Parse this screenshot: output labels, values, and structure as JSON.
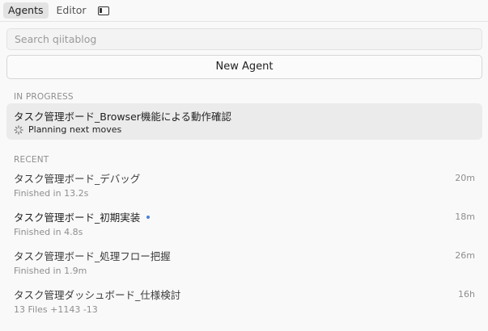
{
  "tabs": [
    {
      "label": "Agents",
      "active": true
    },
    {
      "label": "Editor",
      "active": false
    }
  ],
  "search": {
    "placeholder": "Search qiitablog"
  },
  "new_agent": {
    "label": "New Agent"
  },
  "in_progress": {
    "label": "IN PROGRESS",
    "item": {
      "title": "タスク管理ボード_Browser機能による動作確認",
      "status": "Planning next moves",
      "icon": "spinner-icon"
    }
  },
  "recent": {
    "label": "RECENT",
    "items": [
      {
        "title": "タスク管理ボード_デバッグ",
        "subtitle": "Finished in 13.2s",
        "time": "20m",
        "unread": false
      },
      {
        "title": "タスク管理ボード_初期実装",
        "subtitle": "Finished in 4.8s",
        "time": "18m",
        "unread": true
      },
      {
        "title": "タスク管理ボード_処理フロー把握",
        "subtitle": "Finished in 1.9m",
        "time": "26m",
        "unread": false
      },
      {
        "title": "タスク管理ダッシュボード_仕様検討",
        "subtitle": "13 Files +1143 -13",
        "time": "16h",
        "unread": false
      }
    ]
  },
  "colors": {
    "accent_dot": "#4a7fd9",
    "card_bg": "#ebebeb",
    "muted": "#8e8e8e"
  }
}
